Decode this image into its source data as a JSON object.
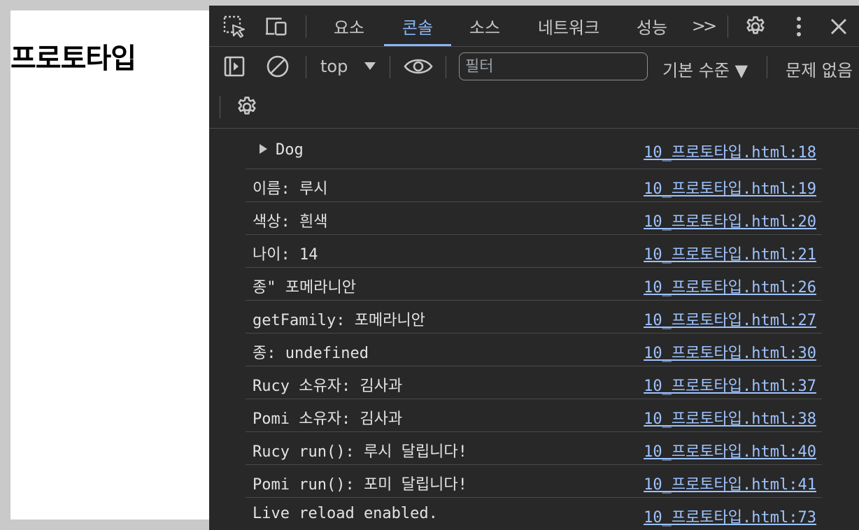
{
  "page": {
    "heading": "프로토타입"
  },
  "devtools": {
    "tabs": [
      {
        "label": "요소"
      },
      {
        "label": "콘솔"
      },
      {
        "label": "소스"
      },
      {
        "label": "네트워크"
      },
      {
        "label": "성능"
      }
    ],
    "more_tabs_label": ">>",
    "console_toolbar": {
      "context": "top",
      "filter_placeholder": "필터",
      "level_label": "기본 수준 ▼",
      "issues_label": "문제 없음"
    }
  },
  "console": {
    "messages": [
      {
        "text": "Dog",
        "source": "10_프로토타입.html:18"
      },
      {
        "text": "이름: 루시",
        "source": "10_프로토타입.html:19"
      },
      {
        "text": "색상: 흰색",
        "source": "10_프로토타입.html:20"
      },
      {
        "text": "나이: 14",
        "source": "10_프로토타입.html:21"
      },
      {
        "text": "종\" 포메라니안",
        "source": "10_프로토타입.html:26"
      },
      {
        "text": "getFamily: 포메라니안",
        "source": "10_프로토타입.html:27"
      },
      {
        "text": "종: undefined",
        "source": "10_프로토타입.html:30"
      },
      {
        "text": "Rucy 소유자: 김사과",
        "source": "10_프로토타입.html:37"
      },
      {
        "text": "Pomi 소유자: 김사과",
        "source": "10_프로토타입.html:38"
      },
      {
        "text": "Rucy run(): 루시 달립니다!",
        "source": "10_프로토타입.html:40"
      },
      {
        "text": "Pomi run(): 포미 달립니다!",
        "source": "10_프로토타입.html:41"
      },
      {
        "text": "Live reload enabled.",
        "source": "10_프로토타입.html:73"
      }
    ]
  },
  "colors": {
    "devtools_bg": "#282828",
    "active_tab": "#8ab4f8",
    "link": "#9ec3ff"
  }
}
